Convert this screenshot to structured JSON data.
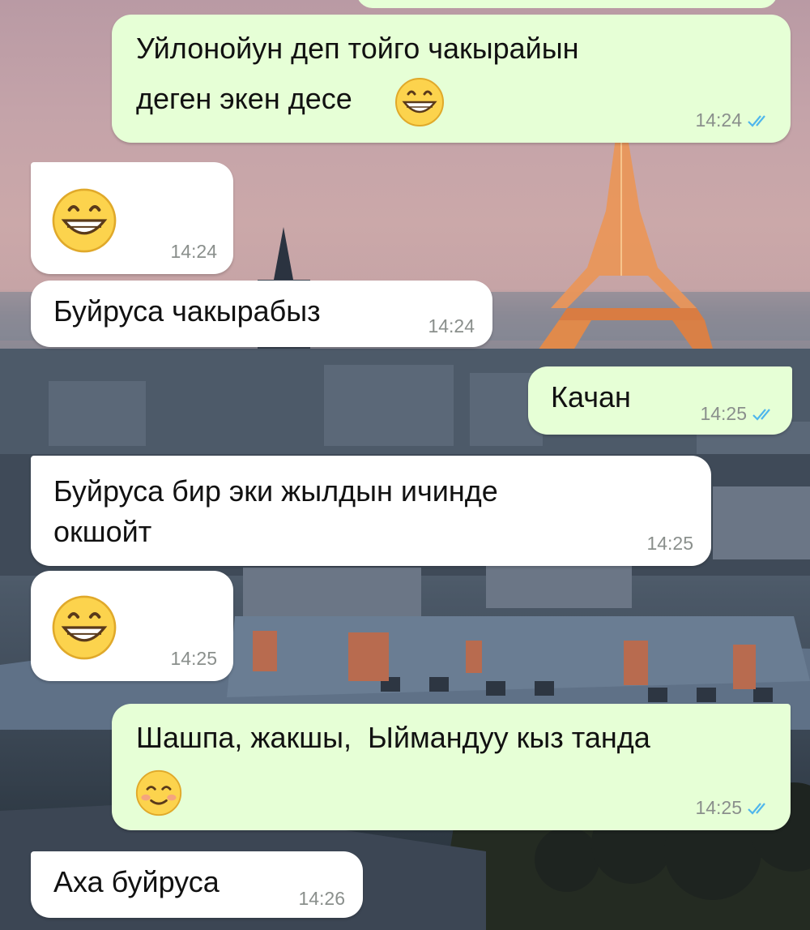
{
  "chat": {
    "messages": [
      {
        "id": "m1",
        "direction": "outgoing",
        "text_line1": "Уйлонойун деп тойго чакырайын",
        "text_line2": "деген экен десе",
        "emoji": "grinning-face-with-smiling-eyes",
        "time": "14:24",
        "read": true
      },
      {
        "id": "m2",
        "direction": "incoming",
        "emoji": "grinning-face-with-smiling-eyes",
        "time": "14:24"
      },
      {
        "id": "m3",
        "direction": "incoming",
        "text": "Буйруса чакырабыз",
        "time": "14:24"
      },
      {
        "id": "m4",
        "direction": "outgoing",
        "text": "Качан",
        "time": "14:25",
        "read": true
      },
      {
        "id": "m5",
        "direction": "incoming",
        "text_line1": "Буйруса бир эки жылдын ичинде",
        "text_line2": "окшойт",
        "time": "14:25"
      },
      {
        "id": "m6",
        "direction": "incoming",
        "emoji": "grinning-face-with-smiling-eyes",
        "time": "14:25"
      },
      {
        "id": "m7",
        "direction": "outgoing",
        "text": "Шашпа, жакшы,  Ыймандуу кыз танда",
        "emoji": "smiling-face-with-smiling-eyes",
        "time": "14:25",
        "read": true
      },
      {
        "id": "m8",
        "direction": "incoming",
        "text": "Аха буйруса",
        "time": "14:26"
      }
    ]
  },
  "colors": {
    "outgoing_bubble": "#e6ffd6",
    "incoming_bubble": "#ffffff",
    "read_ticks": "#4fb6ec",
    "timestamp": "#8a8f8c"
  },
  "icons": {
    "read_receipt": "double-check-icon",
    "wallpaper": "paris-eiffel-tower-wallpaper"
  }
}
